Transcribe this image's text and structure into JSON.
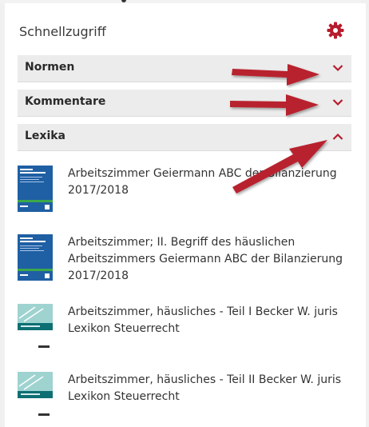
{
  "header": {
    "title": "Schnellzugriff",
    "settings_icon": "gear-icon"
  },
  "colors": {
    "accent": "#b71c2d",
    "annotation_arrow": "#b8232d"
  },
  "sections": [
    {
      "label": "Normen",
      "state": "collapsed"
    },
    {
      "label": "Kommentare",
      "state": "collapsed"
    },
    {
      "label": "Lexika",
      "state": "expanded"
    }
  ],
  "lexika_items": [
    {
      "text": "Arbeitszimmer Geiermann ABC der Bilanzierung 2017/2018"
    },
    {
      "text": "Arbeitszimmer; II. Begriff des häuslichen Arbeitszimmers Geiermann ABC der Bilanzierung 2017/2018"
    },
    {
      "text": "Arbeitszimmer, häusliches - Teil I Becker W. juris Lexikon Steuerrecht"
    },
    {
      "text": "Arbeitszimmer, häusliches - Teil II Becker W. juris Lexikon Steuerrecht"
    }
  ]
}
